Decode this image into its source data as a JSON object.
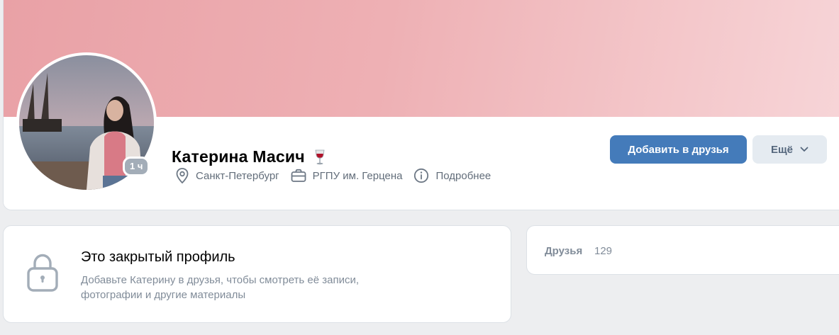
{
  "profile": {
    "name": "Катерина Масич",
    "status_emoji_icon": "wine-glass-icon",
    "online_badge": "1 ч",
    "city": "Санкт-Петербург",
    "education": "РГПУ им. Герцена",
    "more_info": "Подробнее",
    "cover_color": "#eeb0b4"
  },
  "actions": {
    "add_friend": "Добавить в друзья",
    "more": "Ещё"
  },
  "closed_profile": {
    "title": "Это закрытый профиль",
    "description": "Добавьте Катерину в друзья, чтобы смотреть её записи, фотографии и другие материалы"
  },
  "friends": {
    "label": "Друзья",
    "count": "129"
  },
  "colors": {
    "primary_button": "#447bba",
    "secondary_button": "#e5ebf1",
    "muted_text": "#818c99"
  }
}
